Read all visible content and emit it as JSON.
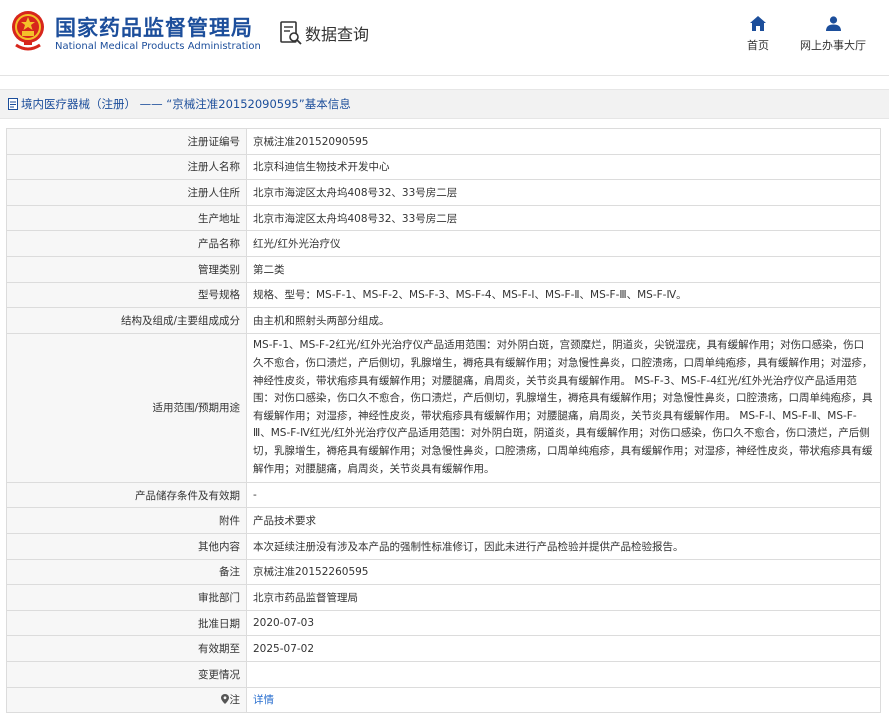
{
  "header": {
    "brand_cn": "国家药品监督管理局",
    "brand_en": "National Medical Products Administration",
    "query_label": "数据查询",
    "nav": {
      "home": "首页",
      "office": "网上办事大厅"
    },
    "logo_icon": "national-emblem-icon",
    "accent": "#1c4e9b"
  },
  "breadcrumb": "境内医疗器械（注册） —— “京械注准20152090595”基本信息",
  "rows": [
    {
      "key": "注册证编号",
      "value": "京械注准20152090595"
    },
    {
      "key": "注册人名称",
      "value": "北京科迪信生物技术开发中心"
    },
    {
      "key": "注册人住所",
      "value": "北京市海淀区太舟坞408号32、33号房二层"
    },
    {
      "key": "生产地址",
      "value": "北京市海淀区太舟坞408号32、33号房二层"
    },
    {
      "key": "产品名称",
      "value": "红光/红外光治疗仪"
    },
    {
      "key": "管理类别",
      "value": "第二类"
    },
    {
      "key": "型号规格",
      "value": "规格、型号：MS-F-1、MS-F-2、MS-F-3、MS-F-4、MS-F-Ⅰ、MS-F-Ⅱ、MS-F-Ⅲ、MS-F-Ⅳ。"
    },
    {
      "key": "结构及组成/主要组成成分",
      "value": "由主机和照射头两部分组成。"
    },
    {
      "key": "适用范围/预期用途",
      "value": "MS-F-1、MS-F-2红光/红外光治疗仪产品适用范围：对外阴白斑，宫颈糜烂，阴道炎，尖锐湿疣，具有缓解作用；对伤口感染，伤口久不愈合，伤口溃烂，产后侧切，乳腺增生，褥疮具有缓解作用；对急慢性鼻炎，口腔溃疡，口周单纯疱疹，具有缓解作用；对湿疹，神经性皮炎，带状疱疹具有缓解作用；对腰腿痛，肩周炎，关节炎具有缓解作用。 MS-F-3、MS-F-4红光/红外光治疗仪产品适用范围：对伤口感染，伤口久不愈合，伤口溃烂，产后侧切，乳腺增生，褥疮具有缓解作用；对急慢性鼻炎，口腔溃疡，口周单纯疱疹，具有缓解作用；对湿疹，神经性皮炎，带状疱疹具有缓解作用；对腰腿痛，肩周炎，关节炎具有缓解作用。 MS-F-Ⅰ、MS-F-Ⅱ、MS-F-Ⅲ、MS-F-Ⅳ红光/红外光治疗仪产品适用范围：对外阴白斑，阴道炎，具有缓解作用；对伤口感染，伤口久不愈合，伤口溃烂，产后侧切，乳腺增生，褥疮具有缓解作用；对急慢性鼻炎，口腔溃疡，口周单纯疱疹，具有缓解作用；对湿疹，神经性皮炎，带状疱疹具有缓解作用；对腰腿痛，肩周炎，关节炎具有缓解作用。"
    },
    {
      "key": "产品储存条件及有效期",
      "value": "-"
    },
    {
      "key": "附件",
      "value": "产品技术要求"
    },
    {
      "key": "其他内容",
      "value": "本次延续注册没有涉及本产品的强制性标准修订，因此未进行产品检验并提供产品检验报告。"
    },
    {
      "key": "备注",
      "value": "京械注准20152260595"
    },
    {
      "key": "审批部门",
      "value": "北京市药品监督管理局"
    },
    {
      "key": "批准日期",
      "value": "2020-07-03"
    },
    {
      "key": "有效期至",
      "value": "2025-07-02"
    },
    {
      "key": "变更情况",
      "value": ""
    },
    {
      "key": "注",
      "value": "详情",
      "key_icon": "location-pin-icon"
    }
  ]
}
